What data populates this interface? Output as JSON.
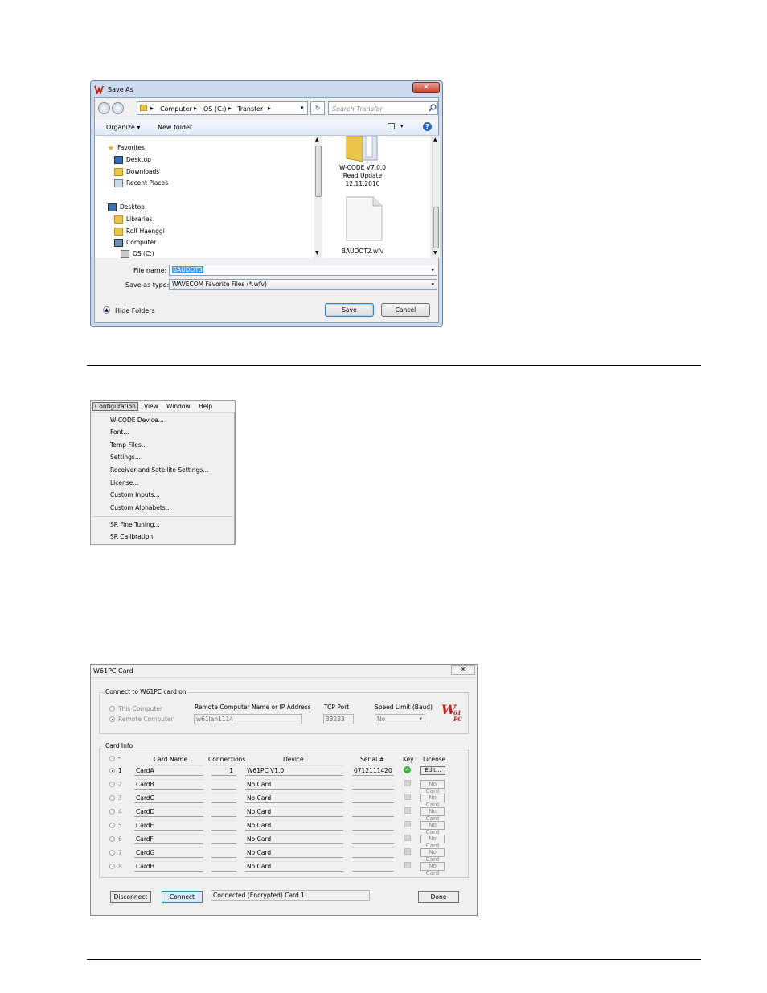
{
  "save_as": {
    "title": "Save As",
    "path": [
      "Computer",
      "OS (C:)",
      "Transfer"
    ],
    "search_placeholder": "Search Transfer",
    "organize": "Organize",
    "new_folder": "New folder",
    "tree": {
      "favorites": "Favorites",
      "desktop": "Desktop",
      "downloads": "Downloads",
      "recent_places": "Recent Places",
      "desktop2": "Desktop",
      "libraries": "Libraries",
      "user": "Rolf Haenggi",
      "computer": "Computer",
      "drive": "OS (C:)"
    },
    "files": [
      {
        "name_line1": "W-CODE V7.0.0",
        "name_line2": "Read Update",
        "name_line3": "12.11.2010",
        "icon": "folder-icon"
      },
      {
        "name": "BAUDOT2.wfv",
        "icon": "file-icon"
      }
    ],
    "file_name_label": "File name:",
    "file_name_value": "BAUDOT3",
    "save_type_label": "Save as type:",
    "save_type_value": "WAVECOM Favorite Files (*.wfv)",
    "hide_folders": "Hide Folders",
    "save_label": "Save",
    "cancel_label": "Cancel"
  },
  "config_menu": {
    "menubar": [
      "Configuration",
      "View",
      "Window",
      "Help"
    ],
    "items": [
      "W-CODE Device...",
      "Font...",
      "Temp Files...",
      "Settings...",
      "Receiver and Satellite Settings...",
      "License...",
      "Custom Inputs...",
      "Custom Alphabets..."
    ],
    "items2": [
      "SR Fine Tuning...",
      "SR Calibration"
    ]
  },
  "w61pc": {
    "title": "W61PC Card",
    "connect_group": "Connect to W61PC card on",
    "this_computer": "This Computer",
    "remote_computer": "Remote Computer",
    "remote_name_label": "Remote Computer Name or IP Address",
    "remote_name_value": "w61lan1114",
    "tcp_port_label": "TCP Port",
    "tcp_port_value": "33233",
    "speed_label": "Speed Limit (Baud)",
    "speed_value": "No",
    "logo_text": "W",
    "logo_sub": "61",
    "logo_pc": "PC",
    "card_info": "Card Info",
    "col_card_name": "Card Name",
    "col_connections": "Connections",
    "col_device": "Device",
    "col_serial": "Serial #",
    "col_key": "Key",
    "col_license": "License",
    "dash": "-",
    "rows": [
      {
        "num": "1",
        "name": "CardA",
        "conn": "1",
        "device": "W61PC V1.0",
        "serial": "0712111420",
        "license": "Edit...",
        "selected": true
      },
      {
        "num": "2",
        "name": "CardB",
        "conn": "",
        "device": "No Card",
        "serial": "",
        "license": "No Card"
      },
      {
        "num": "3",
        "name": "CardC",
        "conn": "",
        "device": "No Card",
        "serial": "",
        "license": "No Card"
      },
      {
        "num": "4",
        "name": "CardD",
        "conn": "",
        "device": "No Card",
        "serial": "",
        "license": "No Card"
      },
      {
        "num": "5",
        "name": "CardE",
        "conn": "",
        "device": "No Card",
        "serial": "",
        "license": "No Card"
      },
      {
        "num": "6",
        "name": "CardF",
        "conn": "",
        "device": "No Card",
        "serial": "",
        "license": "No Card"
      },
      {
        "num": "7",
        "name": "CardG",
        "conn": "",
        "device": "No Card",
        "serial": "",
        "license": "No Card"
      },
      {
        "num": "8",
        "name": "CardH",
        "conn": "",
        "device": "No Card",
        "serial": "",
        "license": "No Card"
      }
    ],
    "disconnect": "Disconnect",
    "connect": "Connect",
    "status": "Connected (Encrypted) Card 1",
    "done": "Done"
  }
}
